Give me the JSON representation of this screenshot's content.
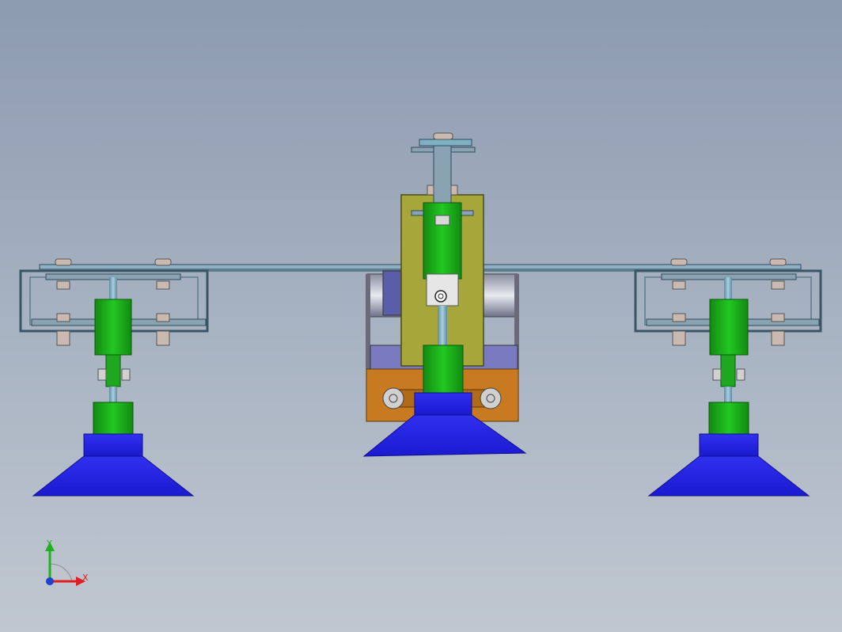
{
  "view": {
    "background_top": "#8d9bb0",
    "background_bottom": "#c0c7d0"
  },
  "triad": {
    "x_label": "X",
    "y_label": "Y",
    "x_color": "#e02020",
    "y_color": "#20b020",
    "z_color": "#2040d0"
  },
  "parts": {
    "suction_cup_color": "#2a2ae6",
    "cylinder_color": "#1fb31f",
    "plate_color": "#a6a63a",
    "base_color": "#c87a20",
    "frame_color": "#7d98aa",
    "rod_color": "#7fa8c0"
  }
}
